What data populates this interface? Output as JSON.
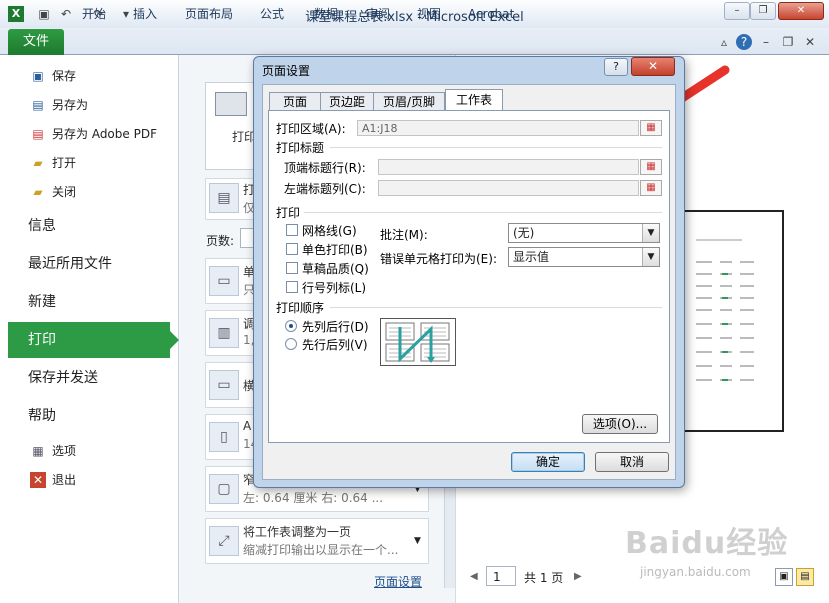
{
  "window": {
    "title": "课堂课程总表.xlsx - Microsoft Excel",
    "minimize": "–",
    "restore": "❐",
    "close": "✕"
  },
  "ribbon_tabs": [
    "文件",
    "开始",
    "插入",
    "页面布局",
    "公式",
    "数据",
    "审阅",
    "视图",
    "Acrobat"
  ],
  "left_nav": {
    "small_top": [
      "保存",
      "另存为",
      "另存为 Adobe PDF",
      "打开",
      "关闭"
    ],
    "big": [
      "信息",
      "最近所用文件",
      "新建",
      "打印",
      "保存并发送",
      "帮助"
    ],
    "small_bottom": [
      "选项",
      "退出"
    ],
    "selected": "打印"
  },
  "middle_panel": {
    "print_button": "打印",
    "pages_label": "页数:",
    "tiles": [
      {
        "title": "打",
        "sub": "仅"
      },
      {
        "title": "单",
        "sub": "只"
      },
      {
        "title": "调",
        "sub": "1,"
      },
      {
        "title": "横",
        "sub": ""
      },
      {
        "title": "A",
        "sub": "14"
      },
      {
        "title": "窄",
        "sub": "左: 0.64 厘米    右: 0.64 ..."
      },
      {
        "title": "将工作表调整为一页",
        "sub": "缩减打印输出以显示在一个..."
      }
    ],
    "page_setup_link": "页面设置"
  },
  "dialog": {
    "title": "页面设置",
    "help": "?",
    "close": "✕",
    "tabs": [
      "页面",
      "页边距",
      "页眉/页脚",
      "工作表"
    ],
    "active_tab": "工作表",
    "print_area_label": "打印区域(A):",
    "print_area_value": "A1:J18",
    "print_titles_label": "打印标题",
    "rows_repeat_label": "顶端标题行(R):",
    "cols_repeat_label": "左端标题列(C):",
    "print_label": "打印",
    "checkboxes": [
      "网格线(G)",
      "单色打印(B)",
      "草稿品质(Q)",
      "行号列标(L)"
    ],
    "comments_label": "批注(M):",
    "comments_value": "(无)",
    "errors_label": "错误单元格打印为(E):",
    "errors_value": "显示值",
    "order_label": "打印顺序",
    "order_options": [
      "先列后行(D)",
      "先行后列(V)"
    ],
    "order_selected": "先列后行(D)",
    "options_button": "选项(O)...",
    "ok_button": "确定",
    "cancel_button": "取消"
  },
  "preview_nav": {
    "page_value": "1",
    "total_pages": "共 1 页"
  },
  "watermark": {
    "text": "Baidu经验",
    "sub": "jingyan.baidu.com"
  }
}
